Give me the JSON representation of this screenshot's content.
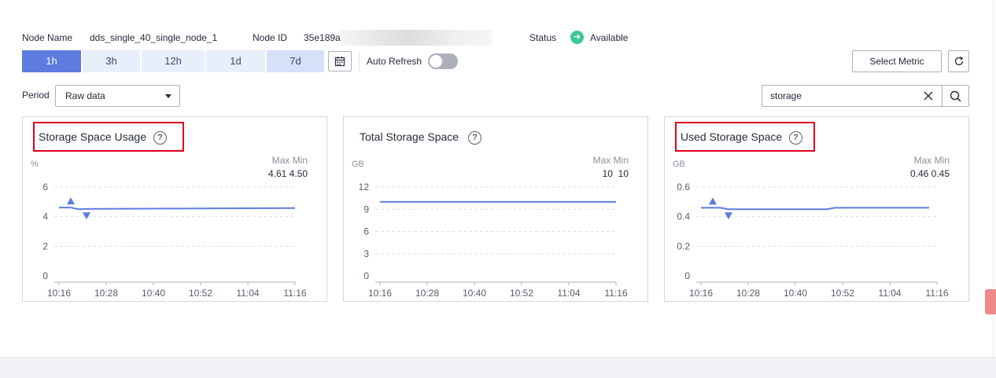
{
  "info": {
    "node_name_label": "Node Name",
    "node_name": "dds_single_40_single_node_1",
    "node_id_label": "Node ID",
    "node_id": "35e189a",
    "status_label": "Status",
    "status": "Available",
    "status_color": "#3cc69a"
  },
  "toolbar": {
    "ranges": [
      "1h",
      "3h",
      "12h",
      "1d",
      "7d"
    ],
    "active_range": "1h",
    "auto_refresh_label": "Auto Refresh",
    "auto_refresh_on": false,
    "select_metric_label": "Select Metric"
  },
  "filter": {
    "period_label": "Period",
    "period_value": "Raw data",
    "search_value": "storage"
  },
  "colors": {
    "accent": "#5e7ce0",
    "highlight_box": "#e0001b"
  },
  "chart_data": [
    {
      "type": "line",
      "title": "Storage Space Usage",
      "unit": "%",
      "max_label": "Max",
      "min_label": "Min",
      "max": "4.61",
      "min": "4.50",
      "x_ticks": [
        "10:16",
        "10:28",
        "10:40",
        "10:52",
        "11:04",
        "11:16"
      ],
      "y_ticks": [
        "0",
        "2",
        "4",
        "6"
      ],
      "ylim": [
        0,
        6
      ],
      "series": [
        {
          "x": [
            0,
            3,
            5,
            7,
            60
          ],
          "values": [
            4.61,
            4.61,
            4.5,
            4.52,
            4.58
          ]
        }
      ],
      "max_marker_x": 3,
      "min_marker_x": 7,
      "highlighted": true
    },
    {
      "type": "line",
      "title": "Total Storage Space",
      "unit": "GB",
      "max_label": "Max",
      "min_label": "Min",
      "max": "10",
      "min": "10",
      "x_ticks": [
        "10:16",
        "10:28",
        "10:40",
        "10:52",
        "11:04",
        "11:16"
      ],
      "y_ticks": [
        "0",
        "3",
        "6",
        "9",
        "12"
      ],
      "ylim": [
        0,
        12
      ],
      "series": [
        {
          "x": [
            0,
            60
          ],
          "values": [
            10,
            10
          ]
        }
      ],
      "highlighted": false
    },
    {
      "type": "line",
      "title": "Used Storage Space",
      "unit": "GB",
      "max_label": "Max",
      "min_label": "Min",
      "max": "0.46",
      "min": "0.45",
      "x_ticks": [
        "10:16",
        "10:28",
        "10:40",
        "10:52",
        "11:04",
        "11:16"
      ],
      "y_ticks": [
        "0",
        "0.2",
        "0.4",
        "0.6"
      ],
      "ylim": [
        0,
        0.6
      ],
      "series": [
        {
          "x": [
            0,
            5,
            7,
            32,
            34,
            58
          ],
          "values": [
            0.46,
            0.46,
            0.45,
            0.45,
            0.46,
            0.46
          ]
        }
      ],
      "max_marker_x": 3,
      "min_marker_x": 7,
      "highlighted": true
    }
  ]
}
